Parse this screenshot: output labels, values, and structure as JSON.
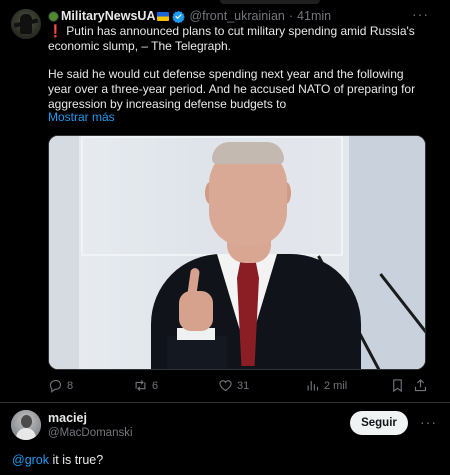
{
  "tweet": {
    "display_name": "MilitaryNewsUA",
    "handle": "@front_ukrainian",
    "time": "41min",
    "more_icon": "···",
    "exclamation": "❗",
    "paragraph1": "Putin has announced plans to cut military spending amid Russia's economic slump, – The Telegraph.",
    "paragraph2": "He said he would cut defense spending next year and the following year over a three-year period. And he accused NATO of preparing for aggression by increasing defense budgets to",
    "show_more": "Mostrar más",
    "actions": {
      "replies": "8",
      "reposts": "6",
      "likes": "31",
      "views": "2 mil"
    }
  },
  "reply": {
    "display_name": "maciej",
    "handle": "@MacDomanski",
    "follow_label": "Seguir",
    "more_icon": "···",
    "mention": "@grok",
    "text": " it is true?"
  },
  "colors": {
    "background": "#000000",
    "text": "#e7e9ea",
    "muted": "#71767b",
    "link": "#1d9bf0",
    "verified": "#1d9bf0",
    "follow_bg": "#eff3f4"
  },
  "icons": [
    "reply-icon",
    "repost-icon",
    "like-icon",
    "views-icon",
    "bookmark-icon",
    "share-icon",
    "verified-badge-icon"
  ]
}
